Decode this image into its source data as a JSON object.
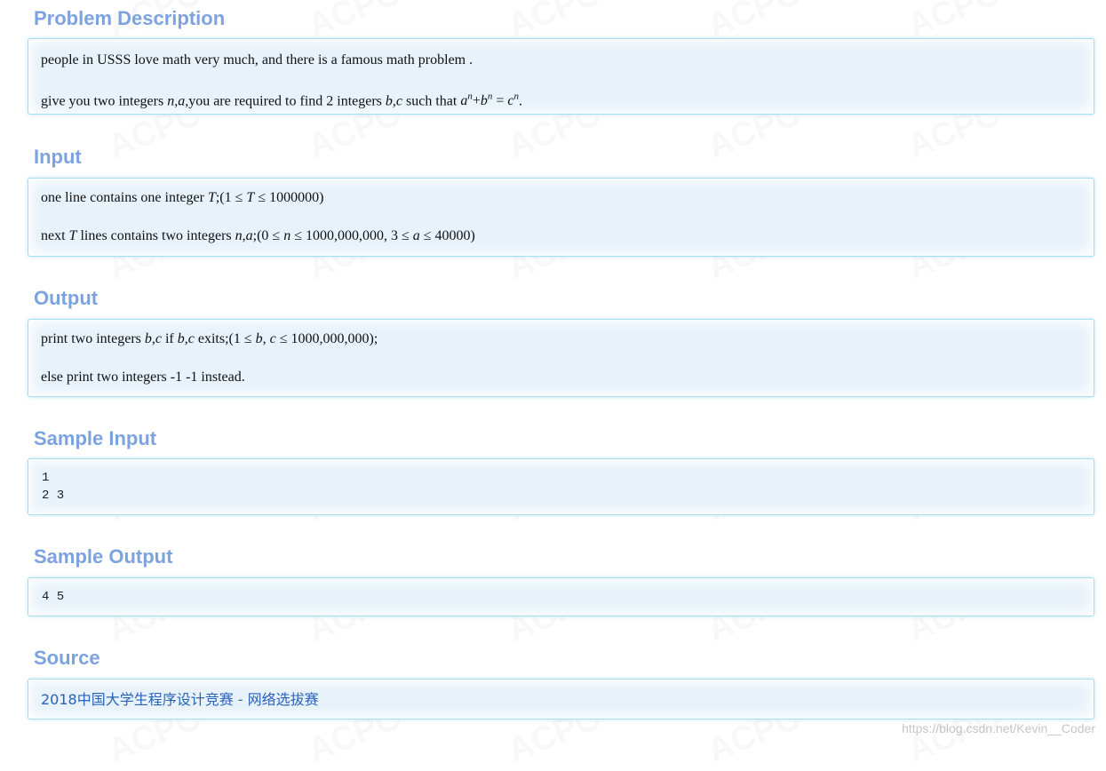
{
  "watermark": {
    "text": "ACPC"
  },
  "sections": {
    "description": {
      "heading": "Problem Description",
      "line1": "people in USSS love math very much, and there is a famous math problem .",
      "line2": {
        "pre": "give you two integers ",
        "var_n": "n",
        "comma1": ",",
        "var_a": "a",
        "mid": ",you are required to find 2 integers ",
        "var_b": "b",
        "comma2": ",",
        "var_c": "c",
        "post": " such that ",
        "eq_a": "a",
        "eq_n1": "n",
        "eq_plus": "+",
        "eq_b": "b",
        "eq_n2": "n",
        "eq_equals": " = ",
        "eq_c": "c",
        "eq_n3": "n",
        "end": "."
      }
    },
    "input": {
      "heading": "Input",
      "line1": {
        "pre": "one line contains one integer ",
        "var_T": "T",
        "mid": ";(1 ≤ ",
        "var_T2": "T",
        "post": " ≤ 1000000)"
      },
      "line2": {
        "pre": "next ",
        "var_T": "T",
        "mid": " lines contains two integers ",
        "var_n": "n",
        "comma": ",",
        "var_a": "a",
        "cond1": ";(0 ≤ ",
        "var_n2": "n",
        "cond2": " ≤ 1000,000,000, 3 ≤ ",
        "var_a2": "a",
        "cond3": " ≤ 40000)"
      }
    },
    "output": {
      "heading": "Output",
      "line1": {
        "pre": "print two integers ",
        "var_b": "b",
        "comma1": ",",
        "var_c": "c",
        "mid": " if ",
        "var_b2": "b",
        "comma2": ",",
        "var_c2": "c",
        "cond1": " exits;(1 ≤ ",
        "var_b3": "b",
        "comma3": ", ",
        "var_c3": "c",
        "cond2": " ≤ 1000,000,000);"
      },
      "line2": "else print two integers -1 -1 instead."
    },
    "sample_input": {
      "heading": "Sample Input",
      "lines": [
        "1",
        "2 3"
      ]
    },
    "sample_output": {
      "heading": "Sample Output",
      "lines": [
        "4 5"
      ]
    },
    "source": {
      "heading": "Source",
      "link_text": "2018中国大学生程序设计竞赛 - 网络选拔赛"
    }
  },
  "credit": "https://blog.csdn.net/Kevin__Coder",
  "colors": {
    "heading": "#7ca3df",
    "panel_bg": "#e7f2fa",
    "panel_border": "#a9def0",
    "link": "#2a62b8"
  }
}
